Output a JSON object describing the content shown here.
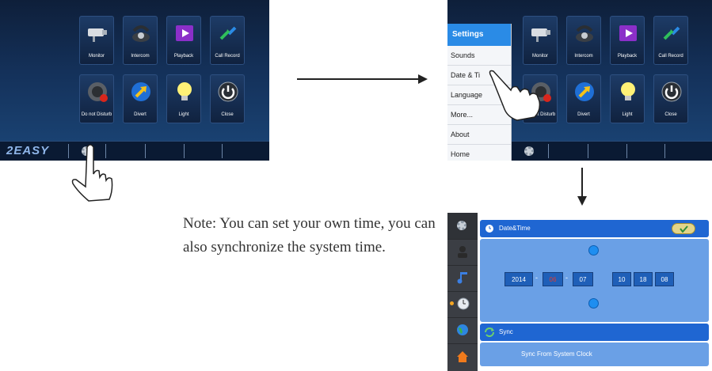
{
  "screen1": {
    "tiles": [
      {
        "label": "Monitor",
        "icon": "camera-icon"
      },
      {
        "label": "Intercom",
        "icon": "phone-icon"
      },
      {
        "label": "Playback",
        "icon": "play-icon"
      },
      {
        "label": "Call Record",
        "icon": "call-record-icon"
      },
      {
        "label": "Do not Disturb",
        "icon": "speaker-mute-icon"
      },
      {
        "label": "Divert",
        "icon": "divert-icon"
      },
      {
        "label": "Light",
        "icon": "bulb-icon"
      },
      {
        "label": "Close",
        "icon": "power-icon"
      }
    ],
    "brand": "2EASY"
  },
  "screen2": {
    "tiles": [
      {
        "label": "Monitor"
      },
      {
        "label": "Intercom"
      },
      {
        "label": "Playback"
      },
      {
        "label": "Call Record"
      },
      {
        "label": "Do not Disturb"
      },
      {
        "label": "Divert"
      },
      {
        "label": "Light"
      },
      {
        "label": "Close"
      }
    ],
    "menu": {
      "header": "Settings",
      "items": [
        "Sounds",
        "Date & Ti",
        "Language",
        "More...",
        "About",
        "Home"
      ]
    }
  },
  "screen3": {
    "header": "Date&Time",
    "year": "2014",
    "month": "06",
    "day": "07",
    "hour": "10",
    "minute": "18",
    "second": "08",
    "date_sep": "-",
    "sync_header": "Sync",
    "sync_button": "Sync From System Clock"
  },
  "note": "Note: You can set your own time, you can also synchronize the system time.",
  "colors": {
    "accent": "#1f66d2",
    "menu_header": "#2a8be6",
    "screen_bg": "#14315a"
  }
}
